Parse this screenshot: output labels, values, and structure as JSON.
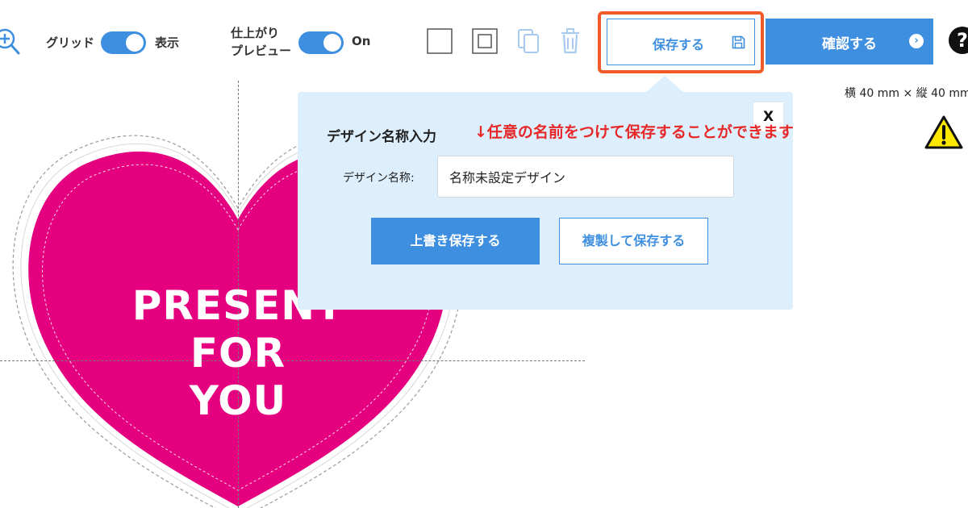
{
  "toolbar": {
    "zoom_icon": "zoom-in-icon",
    "grid_label": "グリッド",
    "grid_state": "表示",
    "preview_label_line1": "仕上がり",
    "preview_label_line2": "プレビュー",
    "preview_state": "On",
    "save_label": "保存する",
    "save_icon": "floppy-icon",
    "confirm_label": "確認する",
    "confirm_icon": "arrow-right-circle-icon",
    "help_icon": "help-icon",
    "help_glyph": "?",
    "size_text": "横 40 mm × 縦 40 mm",
    "warning_icon": "warning-icon"
  },
  "canvas": {
    "text_line1": "PRESENT",
    "text_line2": "FOR",
    "text_line3": "YOU"
  },
  "popup": {
    "title": "デザイン名称入力",
    "hint": "↓任意の名前をつけて保存することができます",
    "close_label": "X",
    "field_label": "デザイン名称:",
    "field_value": "名称未設定デザイン",
    "overwrite_label": "上書き保存する",
    "duplicate_label": "複製して保存する"
  },
  "colors": {
    "accent": "#3f8fe0",
    "highlight": "#f05a28",
    "heart": "#e4007f",
    "popup_bg": "#ddeefc",
    "hint": "#e62828"
  }
}
